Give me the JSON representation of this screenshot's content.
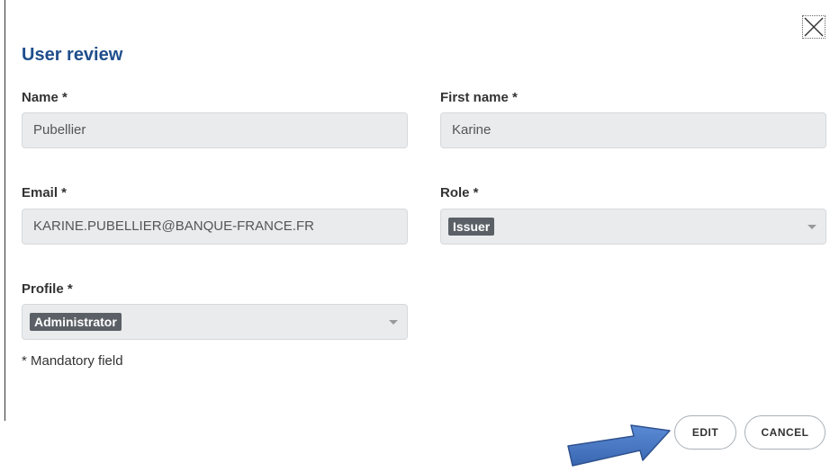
{
  "dialog": {
    "title": "User review",
    "close_icon": "close-icon"
  },
  "fields": {
    "name": {
      "label": "Name *",
      "value": "Pubellier"
    },
    "first_name": {
      "label": "First name *",
      "value": "Karine"
    },
    "email": {
      "label": "Email *",
      "value": "KARINE.PUBELLIER@BANQUE-FRANCE.FR"
    },
    "role": {
      "label": "Role *",
      "selected": "Issuer"
    },
    "profile": {
      "label": "Profile *",
      "selected": "Administrator"
    }
  },
  "mandatory_note": "* Mandatory field",
  "buttons": {
    "edit": "EDIT",
    "cancel": "CANCEL"
  },
  "annotation": {
    "arrow_icon": "right-arrow-icon",
    "arrow_color": "#4472c4"
  },
  "colors": {
    "title": "#1f4e8c",
    "field_background": "#e9ebed",
    "chip_background": "#5a6066"
  }
}
